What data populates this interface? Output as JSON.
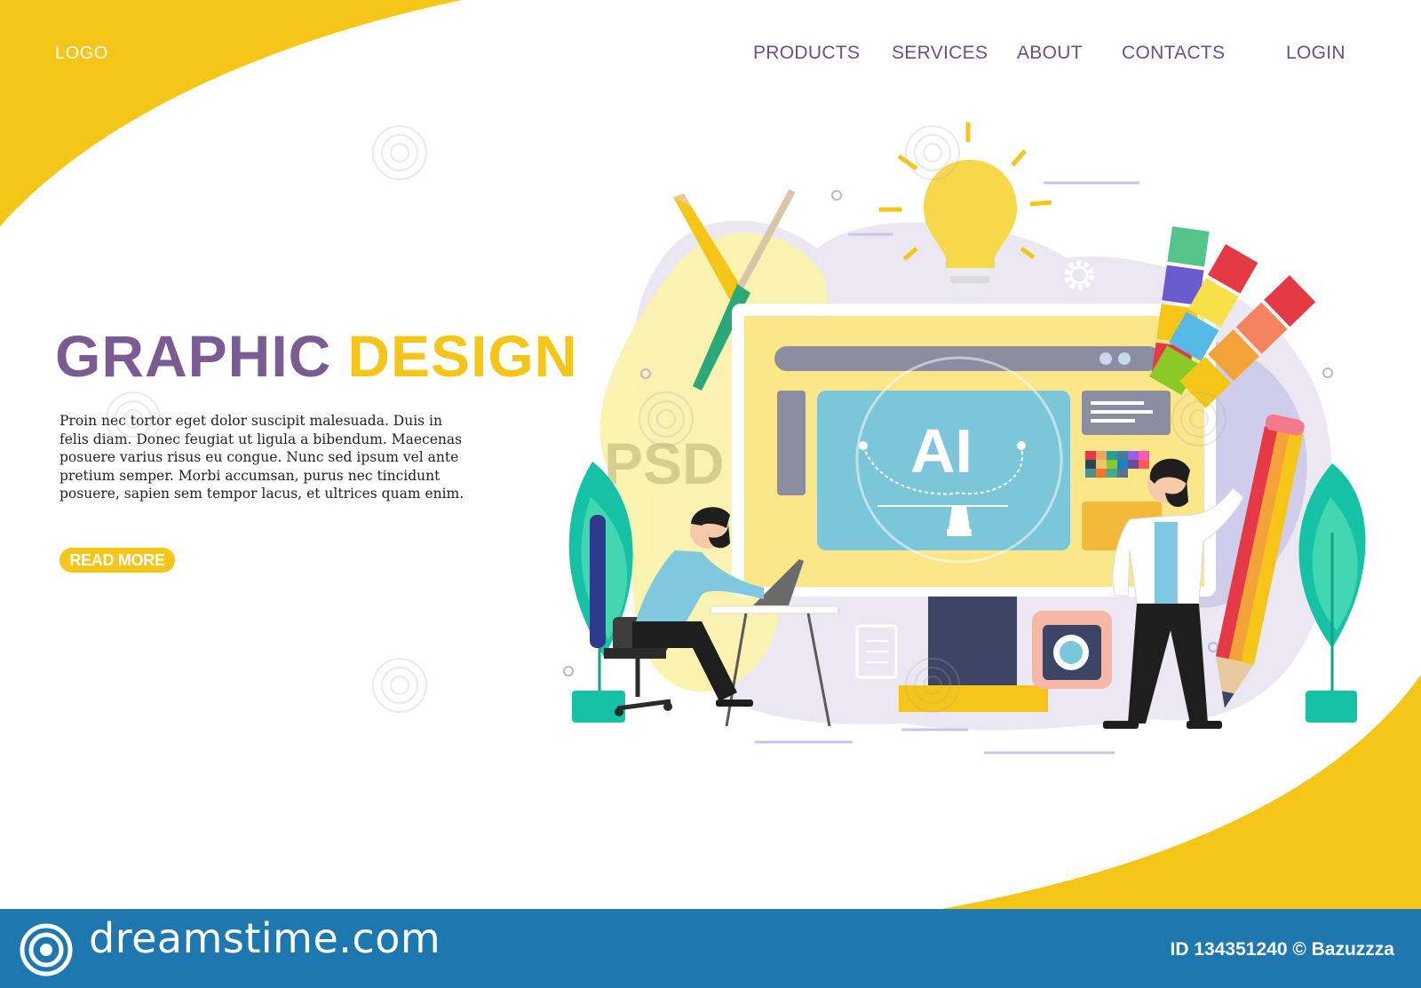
{
  "header": {
    "logo": "LOGO",
    "nav": [
      "PRODUCTS",
      "SERVICES",
      "ABOUT",
      "CONTACTS"
    ],
    "login": "LOGIN"
  },
  "hero": {
    "title_part1": "GRAPHIC",
    "title_part2": "DESIGN",
    "body": "Proin nec tortor eget dolor suscipit malesuada. Duis in felis diam. Donec feugiat ut ligula a bibendum. Maecenas posuere varius risus eu congue. Nunc sed ipsum vel ante pretium semper. Morbi accumsan, purus nec tincidunt posuere, sapien sem tempor lacus, et ultrices quam enim.",
    "button": "READ MORE"
  },
  "illustration": {
    "screen_label": "AI",
    "psd_label": "PSD"
  },
  "footer": {
    "site": "dreamstime.com",
    "id_text": "ID 134351240 © Bazuzzza"
  },
  "colors": {
    "accent_yellow": "#f5c518",
    "purple": "#7b5b94",
    "footer_blue": "#1f77b0"
  },
  "icons": [
    "lightbulb-icon",
    "gear-icon",
    "camera-icon",
    "pencil-icon",
    "brush-icon",
    "clipboard-icon",
    "pen-tool-icon",
    "color-swatch-icon"
  ]
}
